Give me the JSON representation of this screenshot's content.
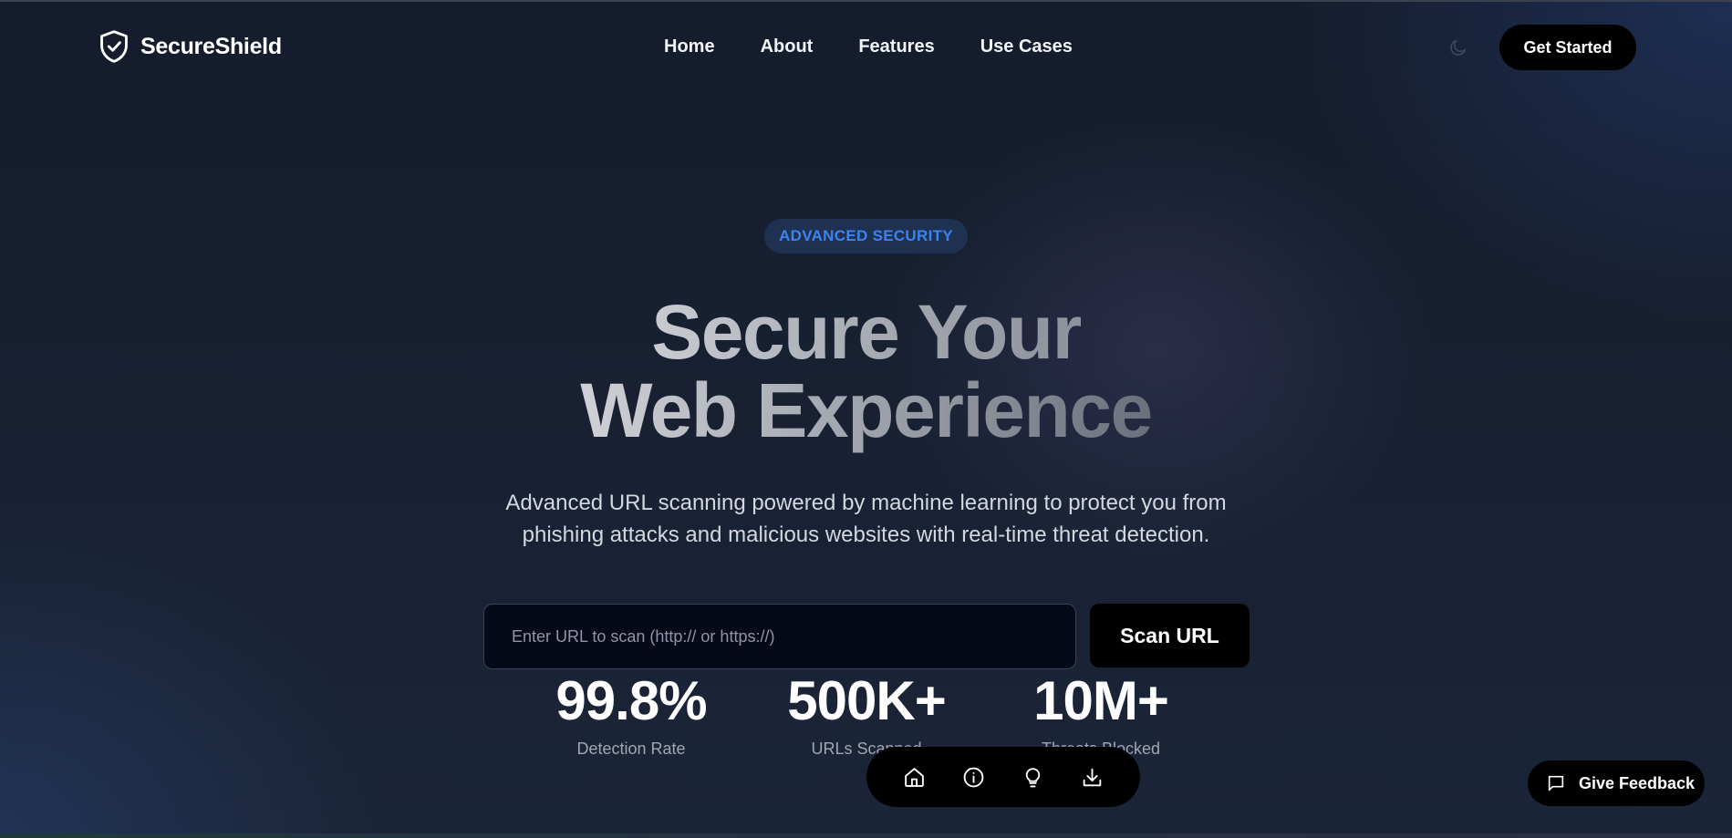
{
  "nav": {
    "brand": "SecureShield",
    "links": [
      "Home",
      "About",
      "Features",
      "Use Cases"
    ],
    "theme_icon": "moon-icon",
    "cta": "Get Started"
  },
  "hero": {
    "badge": "ADVANCED SECURITY",
    "title_line1": "Secure Your",
    "title_line2": "Web Experience",
    "subtitle_line1": "Advanced URL scanning powered by machine learning to protect you from",
    "subtitle_line2": "phishing attacks and malicious websites with real-time threat detection.",
    "search_placeholder": "Enter URL to scan (http:// or https://)",
    "search_value": "",
    "scan_button": "Scan URL"
  },
  "stats": [
    {
      "value": "99.8%",
      "label": "Detection Rate"
    },
    {
      "value": "500K+",
      "label": "URLs Scanned"
    },
    {
      "value": "10M+",
      "label": "Threats Blocked"
    }
  ],
  "dock": {
    "icons": [
      "home-icon",
      "info-icon",
      "lightbulb-icon",
      "download-icon"
    ]
  },
  "feedback": {
    "label": "Give Feedback",
    "icon": "message-square-icon"
  },
  "colors": {
    "background": "#141b2b",
    "badge_text": "#3d83f0",
    "badge_bg": "#1e3150",
    "button_bg": "#000000"
  }
}
